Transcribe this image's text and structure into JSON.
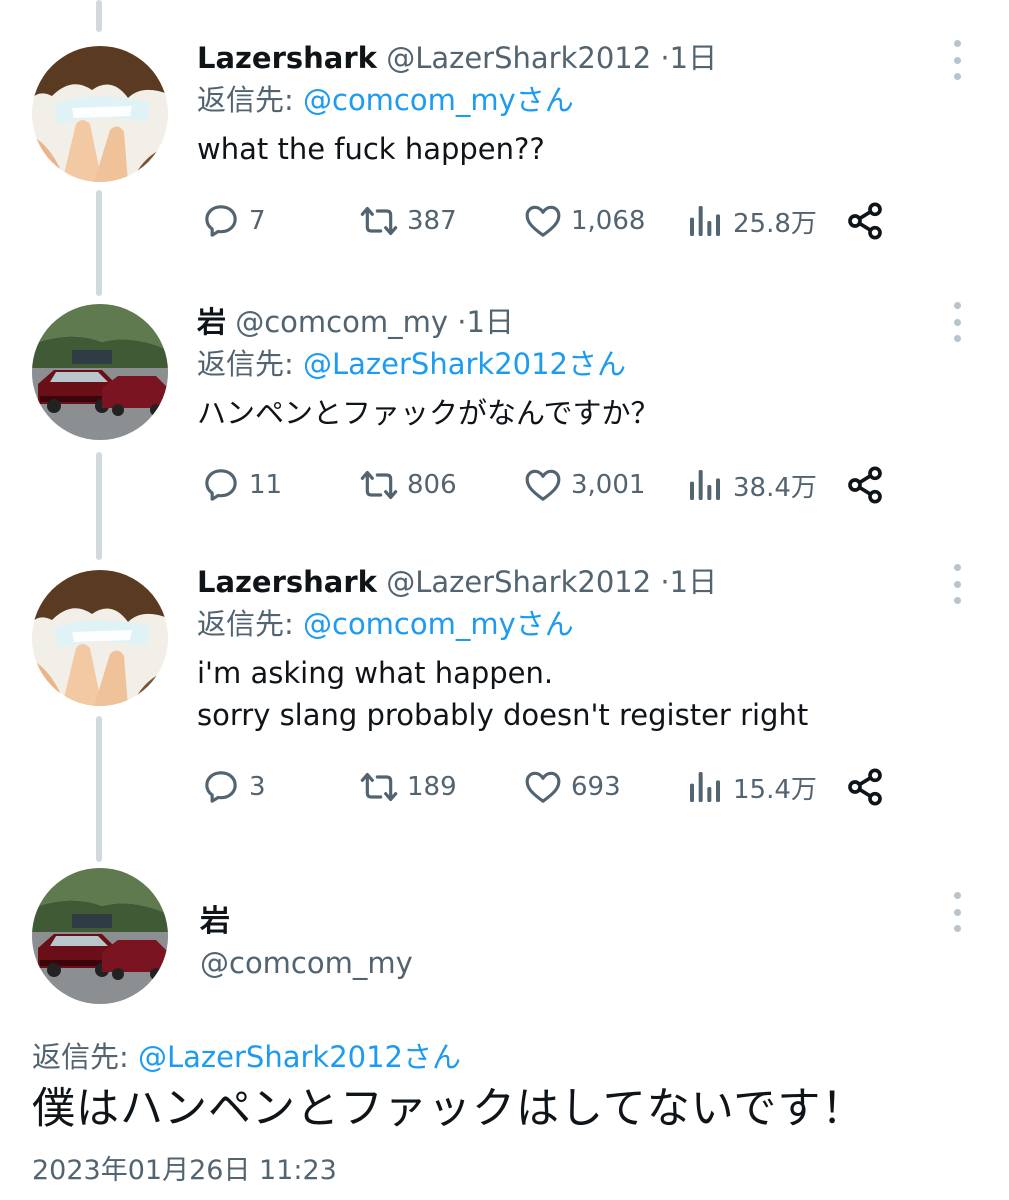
{
  "tweets": [
    {
      "name": "Lazershark",
      "handle": "@LazerShark2012",
      "dot": "·",
      "time": "1日",
      "reply_prefix": "返信先: ",
      "reply_mention": "@comcom_myさん",
      "text": "what the fuck happen??",
      "replies": "7",
      "retweets": "387",
      "likes": "1,068",
      "views": "25.8万",
      "avatar": "anime-character"
    },
    {
      "name": "岩",
      "handle": "@comcom_my",
      "dot": "·",
      "time": "1日",
      "reply_prefix": "返信先: ",
      "reply_mention": "@LazerShark2012さん",
      "text": "ハンペンとファックがなんですか？",
      "replies": "11",
      "retweets": "806",
      "likes": "3,001",
      "views": "38.4万",
      "avatar": "red-cars"
    },
    {
      "name": "Lazershark",
      "handle": "@LazerShark2012",
      "dot": "·",
      "time": "1日",
      "reply_prefix": "返信先: ",
      "reply_mention": "@comcom_myさん",
      "text": "i'm asking what happen.\nsorry slang probably doesn't register right",
      "replies": "3",
      "retweets": "189",
      "likes": "693",
      "views": "15.4万",
      "avatar": "anime-character"
    }
  ],
  "main_tweet": {
    "name": "岩",
    "handle": "@comcom_my",
    "reply_prefix": "返信先: ",
    "reply_mention": "@LazerShark2012さん",
    "text": "僕はハンペンとファックはしてないです！",
    "date": "2023年01月26日 11:23",
    "avatar": "red-cars"
  },
  "icons": {
    "reply": "speech-bubble-icon",
    "retweet": "retweet-icon",
    "like": "heart-icon",
    "views": "bar-chart-icon",
    "share": "share-icon",
    "more": "more-vertical-icon"
  },
  "colors": {
    "mention": "#1d9bf0",
    "secondary": "#536471",
    "thread_line": "#cfd9de"
  }
}
